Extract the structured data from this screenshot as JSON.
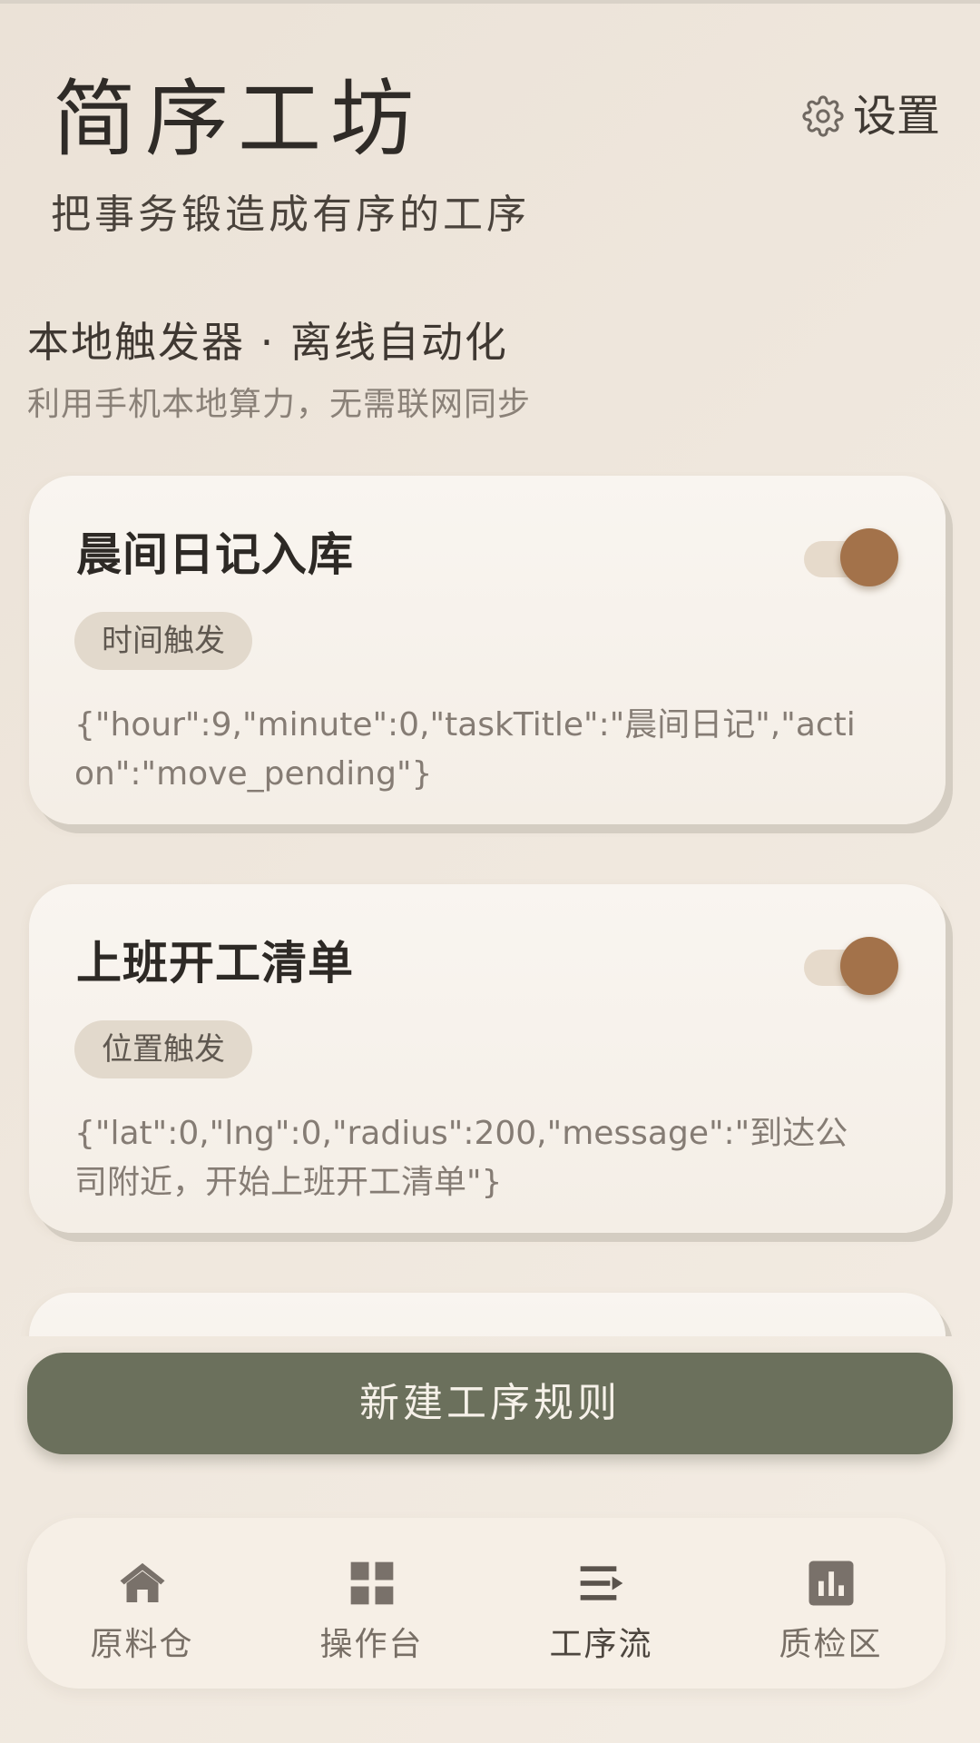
{
  "header": {
    "title": "简序工坊",
    "subtitle": "把事务锻造成有序的工序",
    "settings_label": "设置",
    "settings_icon": "gear-icon"
  },
  "section": {
    "title": "本地触发器 · 离线自动化",
    "subtitle": "利用手机本地算力，无需联网同步"
  },
  "rules": [
    {
      "name": "晨间日记入库",
      "enabled": true,
      "trigger_tag": "时间触发",
      "params": "{\"hour\":9,\"minute\":0,\"taskTitle\":\"晨间日记\",\"action\":\"move_pending\"}"
    },
    {
      "name": "上班开工清单",
      "enabled": true,
      "trigger_tag": "位置触发",
      "params": "{\"lat\":0,\"lng\":0,\"radius\":200,\"message\":\"到达公司附近，开始上班开工清单\"}"
    }
  ],
  "new_rule_button": "新建工序规则",
  "bottom_nav": {
    "active": 2,
    "items": [
      {
        "label": "原料仓",
        "icon": "home-icon"
      },
      {
        "label": "操作台",
        "icon": "grid-icon"
      },
      {
        "label": "工序流",
        "icon": "flow-list-icon"
      },
      {
        "label": "质检区",
        "icon": "bar-chart-icon"
      }
    ]
  },
  "colors": {
    "accent_brown": "#a3724a",
    "button_olive": "#6b705c",
    "tag_background": "#e2d9cc"
  }
}
